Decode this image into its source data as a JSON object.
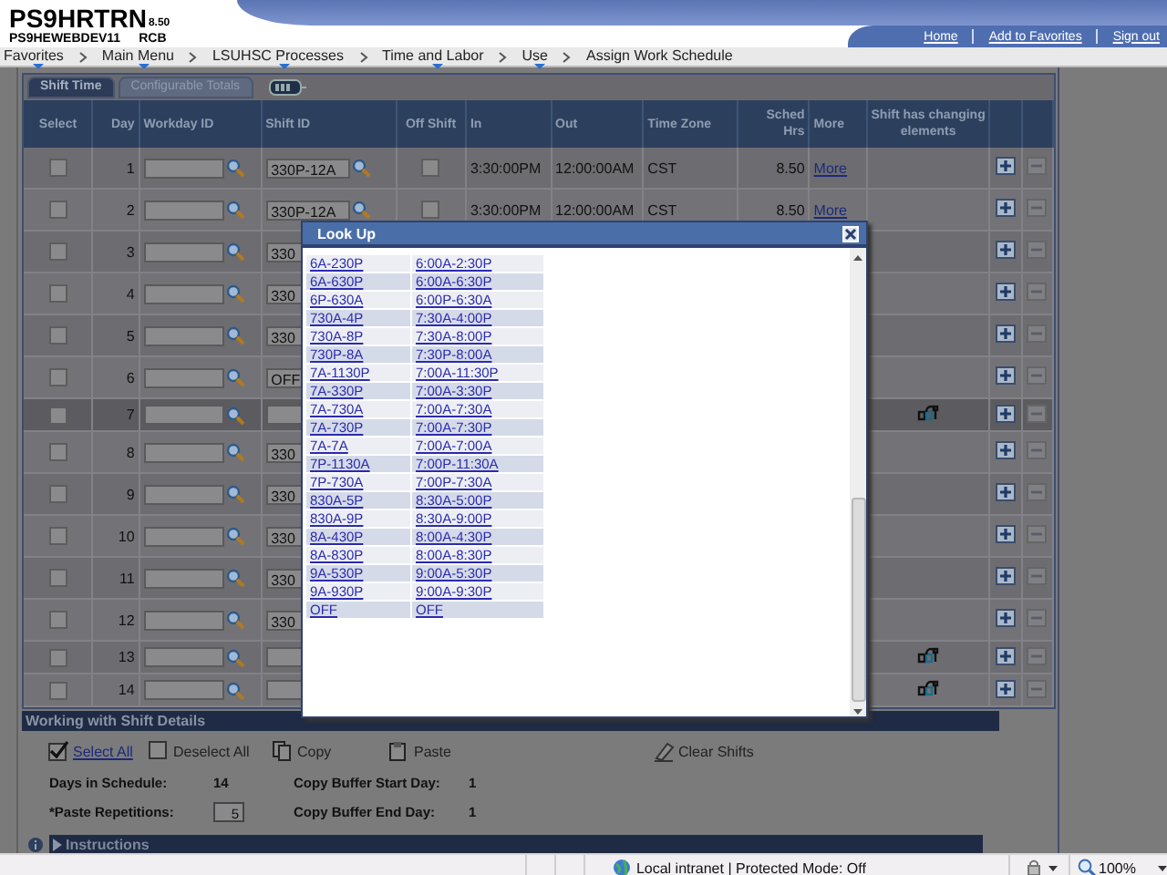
{
  "header": {
    "app_name": "PS9HRTRN",
    "version": "8.50",
    "server": "PS9HEWEBDEV11",
    "user": "RCB",
    "links": [
      "Home",
      "Add to Favorites",
      "Sign out"
    ]
  },
  "breadcrumb": [
    {
      "label": "Favorites",
      "has_menu": true
    },
    {
      "label": "Main Menu",
      "has_menu": true
    },
    {
      "label": "LSUHSC Processes",
      "has_menu": true
    },
    {
      "label": "Time and Labor",
      "has_menu": true
    },
    {
      "label": "Use",
      "has_menu": true
    },
    {
      "label": "Assign Work Schedule",
      "has_menu": false
    }
  ],
  "tabs": [
    {
      "label": "Shift Time",
      "selected": true
    },
    {
      "label": "Configurable Totals",
      "selected": false
    }
  ],
  "table": {
    "columns": [
      "Select",
      "Day",
      "Workday ID",
      "Shift ID",
      "Off Shift",
      "In",
      "Out",
      "Time Zone",
      "Sched Hrs",
      "More",
      "Shift has changing elements"
    ],
    "rows": [
      {
        "selected": false,
        "day": "1",
        "shift_id": "330P-12A",
        "off_shift": false,
        "in": "3:30:00PM",
        "out": "12:00:00AM",
        "time_zone": "CST",
        "sched_hrs": "8.50",
        "more": "More",
        "changing": false,
        "highlighted": false
      },
      {
        "selected": false,
        "day": "2",
        "shift_id": "330P-12A",
        "off_shift": false,
        "in": "3:30:00PM",
        "out": "12:00:00AM",
        "time_zone": "CST",
        "sched_hrs": "8.50",
        "more": "More",
        "changing": false,
        "highlighted": false
      },
      {
        "selected": false,
        "day": "3",
        "shift_id": "330",
        "changing": false,
        "highlighted": false
      },
      {
        "selected": false,
        "day": "4",
        "shift_id": "330",
        "changing": false,
        "highlighted": false
      },
      {
        "selected": false,
        "day": "5",
        "shift_id": "330",
        "changing": false,
        "highlighted": false
      },
      {
        "selected": false,
        "day": "6",
        "shift_id": "OFF",
        "changing": false,
        "highlighted": false
      },
      {
        "selected": false,
        "day": "7",
        "changing": true,
        "highlighted": true
      },
      {
        "selected": false,
        "day": "8",
        "shift_id": "330",
        "changing": false,
        "highlighted": false
      },
      {
        "selected": false,
        "day": "9",
        "shift_id": "330",
        "changing": false,
        "highlighted": false
      },
      {
        "selected": false,
        "day": "10",
        "shift_id": "330",
        "changing": false,
        "highlighted": false
      },
      {
        "selected": false,
        "day": "11",
        "shift_id": "330",
        "changing": false,
        "highlighted": false
      },
      {
        "selected": false,
        "day": "12",
        "shift_id": "330",
        "changing": false,
        "highlighted": false
      },
      {
        "selected": false,
        "day": "13",
        "changing": true,
        "highlighted": false
      },
      {
        "selected": false,
        "day": "14",
        "changing": true,
        "highlighted": false
      }
    ]
  },
  "shift_details": {
    "title": "Working with Shift Details",
    "actions": [
      {
        "label": "Select All",
        "kind": "checked"
      },
      {
        "label": "Deselect All",
        "kind": "unchecked"
      },
      {
        "label": "Copy",
        "kind": "copy"
      },
      {
        "label": "Paste",
        "kind": "paste"
      },
      {
        "label": "Clear Shifts",
        "kind": "clear"
      }
    ],
    "days_label": "Days in Schedule:",
    "days_value": "14",
    "reps_label": "*Paste Repetitions:",
    "reps_value": "5",
    "start_label": "Copy Buffer Start Day:",
    "start_value": "1",
    "end_label": "Copy Buffer End Day:",
    "end_value": "1",
    "instructions": "Instructions"
  },
  "lookup": {
    "title": "Look Up",
    "rows": [
      [
        "6A-230P",
        "6:00A-2:30P"
      ],
      [
        "6A-630P",
        "6:00A-6:30P"
      ],
      [
        "6P-630A",
        "6:00P-6:30A"
      ],
      [
        "730A-4P",
        "7:30A-4:00P"
      ],
      [
        "730A-8P",
        "7:30A-8:00P"
      ],
      [
        "730P-8A",
        "7:30P-8:00A"
      ],
      [
        "7A-1130P",
        "7:00A-11:30P"
      ],
      [
        "7A-330P",
        "7:00A-3:30P"
      ],
      [
        "7A-730A",
        "7:00A-7:30A"
      ],
      [
        "7A-730P",
        "7:00A-7:30P"
      ],
      [
        "7A-7A",
        "7:00A-7:00A"
      ],
      [
        "7P-1130A",
        "7:00P-11:30A"
      ],
      [
        "7P-730A",
        "7:00P-7:30A"
      ],
      [
        "830A-5P",
        "8:30A-5:00P"
      ],
      [
        "830A-9P",
        "8:30A-9:00P"
      ],
      [
        "8A-430P",
        "8:00A-4:30P"
      ],
      [
        "8A-830P",
        "8:00A-8:30P"
      ],
      [
        "9A-530P",
        "9:00A-5:30P"
      ],
      [
        "9A-930P",
        "9:00A-9:30P"
      ],
      [
        "OFF",
        "OFF"
      ]
    ]
  },
  "status_bar": {
    "zone": "Local intranet | Protected Mode: Off",
    "zoom": "100%"
  }
}
